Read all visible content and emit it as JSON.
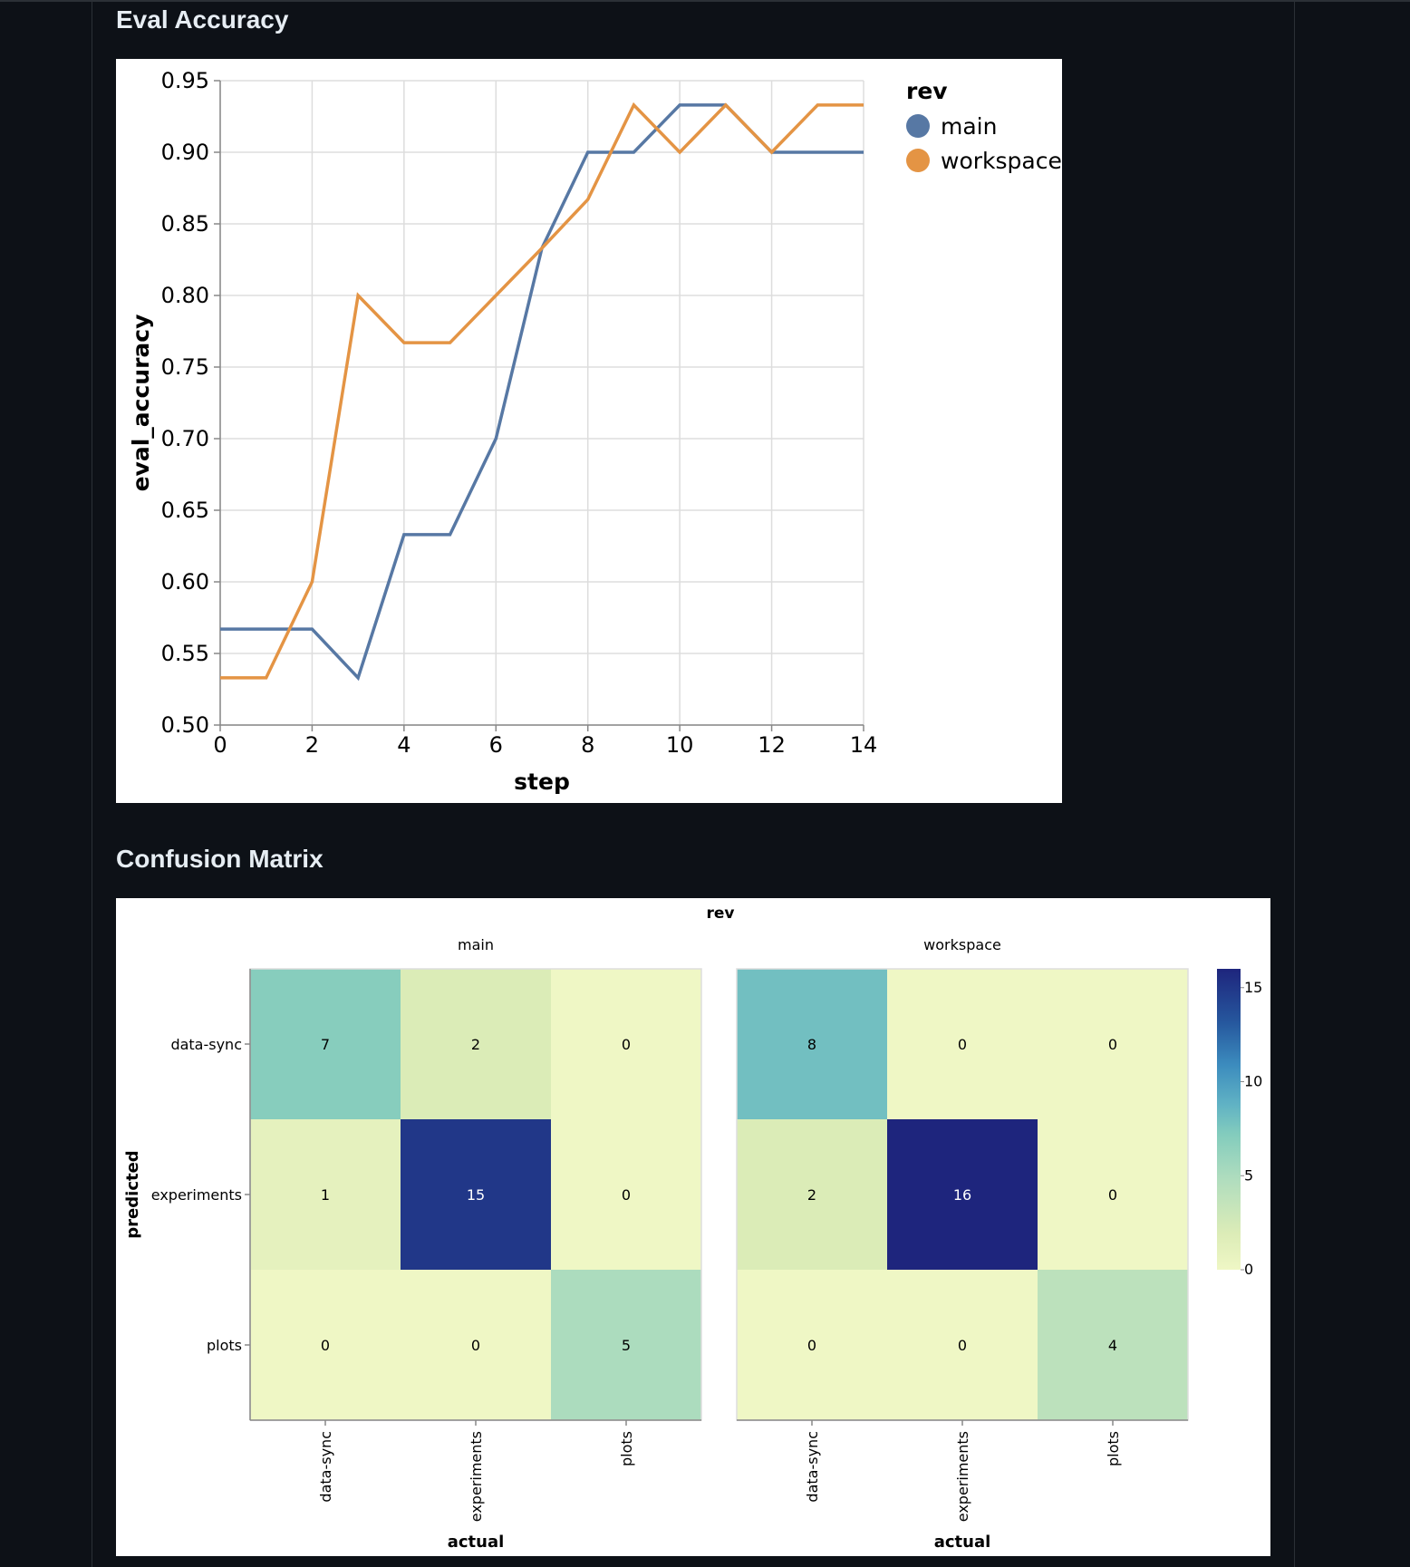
{
  "sections": {
    "eval_title": "Eval Accuracy",
    "cm_title": "Confusion Matrix"
  },
  "colors": {
    "main": "#5778a4",
    "workspace": "#e49444",
    "page_bg": "#0d1117",
    "title_text": "#e6edf3"
  },
  "chart_data": [
    {
      "type": "line",
      "x": [
        0,
        1,
        2,
        3,
        4,
        5,
        6,
        7,
        8,
        9,
        10,
        11,
        12,
        13,
        14
      ],
      "series": [
        {
          "name": "main",
          "color": "#5778a4",
          "values": [
            0.567,
            0.567,
            0.567,
            0.533,
            0.633,
            0.633,
            0.7,
            0.833,
            0.9,
            0.9,
            0.933,
            0.933,
            0.9,
            0.9,
            0.9
          ]
        },
        {
          "name": "workspace",
          "color": "#e49444",
          "values": [
            0.533,
            0.533,
            0.6,
            0.8,
            0.767,
            0.767,
            0.8,
            0.833,
            0.867,
            0.933,
            0.9,
            0.933,
            0.9,
            0.933,
            0.933
          ]
        }
      ],
      "xlabel": "step",
      "ylabel": "eval_accuracy",
      "xlim": [
        0,
        14
      ],
      "ylim": [
        0.5,
        0.95
      ],
      "xticks": [
        0,
        2,
        4,
        6,
        8,
        10,
        12,
        14
      ],
      "yticks": [
        0.5,
        0.55,
        0.6,
        0.65,
        0.7,
        0.75,
        0.8,
        0.85,
        0.9,
        0.95
      ],
      "ytick_labels": [
        "0.50",
        "0.55",
        "0.60",
        "0.65",
        "0.70",
        "0.75",
        "0.80",
        "0.85",
        "0.90",
        "0.95"
      ],
      "grid": true,
      "legend_title": "rev",
      "legend_position": "right"
    },
    {
      "type": "heatmap",
      "facet_title": "rev",
      "x_categories": [
        "data-sync",
        "experiments",
        "plots"
      ],
      "y_categories": [
        "data-sync",
        "experiments",
        "plots"
      ],
      "xlabel": "actual",
      "ylabel": "predicted",
      "facets": [
        {
          "name": "main",
          "values": [
            [
              7,
              2,
              0
            ],
            [
              1,
              15,
              0
            ],
            [
              0,
              0,
              5
            ]
          ]
        },
        {
          "name": "workspace",
          "values": [
            [
              8,
              0,
              0
            ],
            [
              2,
              16,
              0
            ],
            [
              0,
              0,
              4
            ]
          ]
        }
      ],
      "color_scale": {
        "min": 0,
        "max": 16,
        "ticks": [
          0,
          5,
          10,
          15
        ],
        "scheme": "yellow-green-blue"
      }
    }
  ]
}
